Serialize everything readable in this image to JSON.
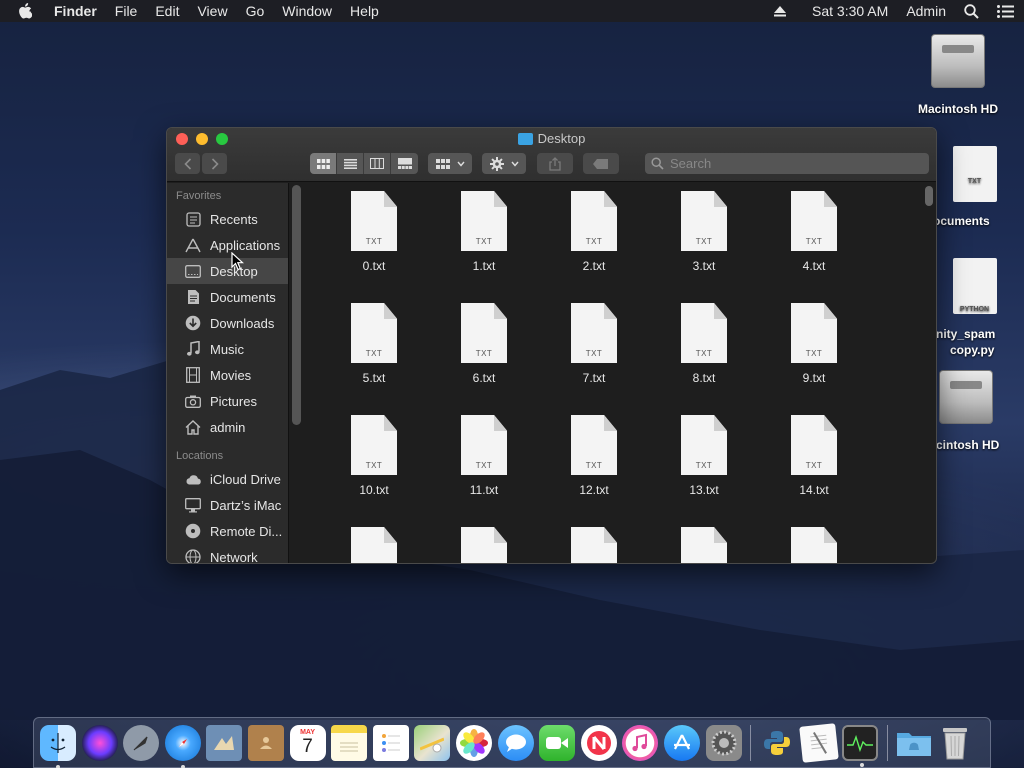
{
  "menubar": {
    "app_name": "Finder",
    "menus": [
      "File",
      "Edit",
      "View",
      "Go",
      "Window",
      "Help"
    ],
    "clock": "Sat 3:30 AM",
    "user": "Admin"
  },
  "desktop_icons": [
    {
      "label": "Macintosh HD",
      "kind": "drive"
    },
    {
      "label": "ocuments",
      "kind": "doc",
      "badge": "TXT"
    },
    {
      "label": "nity_spam",
      "label2": "copy.py",
      "kind": "doc",
      "badge": "PYTHON"
    },
    {
      "label": "cintosh HD",
      "kind": "drive"
    }
  ],
  "window": {
    "title": "Desktop",
    "search_placeholder": "Search",
    "colors": {
      "close": "#fe5f57",
      "minimize": "#febc2e",
      "zoom": "#28c840"
    }
  },
  "sidebar": {
    "favorites_header": "Favorites",
    "favorites": [
      {
        "label": "Recents",
        "icon": "clock-icon"
      },
      {
        "label": "Applications",
        "icon": "applications-icon"
      },
      {
        "label": "Desktop",
        "icon": "desktop-icon",
        "selected": true
      },
      {
        "label": "Documents",
        "icon": "document-icon"
      },
      {
        "label": "Downloads",
        "icon": "download-icon"
      },
      {
        "label": "Music",
        "icon": "music-note-icon"
      },
      {
        "label": "Movies",
        "icon": "film-icon"
      },
      {
        "label": "Pictures",
        "icon": "camera-icon"
      },
      {
        "label": "admin",
        "icon": "home-icon"
      }
    ],
    "locations_header": "Locations",
    "locations": [
      {
        "label": "iCloud Drive",
        "icon": "cloud-icon"
      },
      {
        "label": "Dartz’s iMac",
        "icon": "imac-icon"
      },
      {
        "label": "Remote Di...",
        "icon": "disc-icon"
      },
      {
        "label": "Network",
        "icon": "globe-icon"
      }
    ]
  },
  "files": {
    "badge": "TXT",
    "items": [
      "0.txt",
      "1.txt",
      "2.txt",
      "3.txt",
      "4.txt",
      "5.txt",
      "6.txt",
      "7.txt",
      "8.txt",
      "9.txt",
      "10.txt",
      "11.txt",
      "12.txt",
      "13.txt",
      "14.txt",
      "",
      "",
      "",
      "",
      ""
    ]
  },
  "dock": {
    "calendar_month": "MAY",
    "calendar_day": "7",
    "apps": [
      "finder-icon",
      "siri-icon",
      "launchpad-icon",
      "safari-icon",
      "mail-icon",
      "contacts-icon",
      "calendar-icon",
      "notes-icon",
      "reminders-icon",
      "maps-icon",
      "photos-icon",
      "messages-icon",
      "facetime-icon",
      "news-icon",
      "itunes-icon",
      "app-store-icon",
      "system-preferences-icon",
      "python-launcher-icon",
      "textedit-icon",
      "activity-monitor-icon",
      "folder-icon",
      "trash-icon"
    ]
  }
}
